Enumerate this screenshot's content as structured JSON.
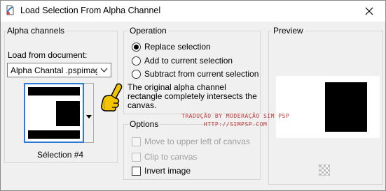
{
  "window": {
    "title": "Load Selection From Alpha Channel"
  },
  "alpha_group": {
    "title": "Alpha channels",
    "load_from_label": "Load from document:",
    "document_select_value": "Alpha Chantal .pspimage",
    "selection_name": "Sélection #4"
  },
  "operation": {
    "title": "Operation",
    "options": [
      {
        "label": "Replace selection",
        "selected": true
      },
      {
        "label": "Add to current selection",
        "selected": false
      },
      {
        "label": "Subtract from current selection",
        "selected": false
      }
    ],
    "description": "The original alpha channel rectangle completely intersects the canvas."
  },
  "options": {
    "title": "Options",
    "move_upper_left": {
      "label": "Move to upper left of canvas",
      "checked": false,
      "enabled": false
    },
    "clip_canvas": {
      "label": "Clip to canvas",
      "checked": false,
      "enabled": false
    },
    "invert_image": {
      "label": "Invert image",
      "checked": false,
      "enabled": true
    }
  },
  "preview": {
    "title": "Preview"
  },
  "watermark": {
    "line1": "TRADUÇÃO BY MODERAÇÃO SIM PSP",
    "line2": "HTTP://SIMPSP.COM"
  },
  "icons": {
    "app": "psp-app-icon",
    "close": "close-icon",
    "dropdown": "chevron-down-icon",
    "pointer": "pointing-hand-icon",
    "zoom": "checkerboard-zoom-icon"
  },
  "colors": {
    "accent": "#2e7bd6",
    "watermark": "#c23a3a"
  }
}
